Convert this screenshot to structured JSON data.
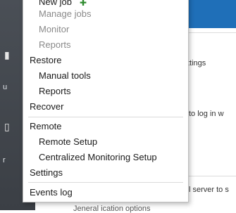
{
  "background": {
    "rail_fragments": [
      "u",
      "r"
    ],
    "right_fragments": [
      "ttings",
      "to log in w",
      "l server to s"
    ],
    "bottom_fragment": "Jeneral ication options"
  },
  "menu": {
    "items": [
      {
        "label": "New job",
        "level": "sub",
        "state": "enabled"
      },
      {
        "label": "Manage jobs",
        "level": "sub",
        "state": "disabled"
      },
      {
        "label": "Monitor",
        "level": "sub",
        "state": "disabled"
      },
      {
        "label": "Reports",
        "level": "sub",
        "state": "disabled"
      },
      {
        "label": "Restore",
        "level": "top",
        "state": "enabled"
      },
      {
        "label": "Manual tools",
        "level": "sub",
        "state": "enabled"
      },
      {
        "label": "Reports",
        "level": "sub",
        "state": "enabled"
      },
      {
        "label": "Recover",
        "level": "top",
        "state": "enabled"
      },
      {
        "label": "Remote",
        "level": "top",
        "state": "enabled"
      },
      {
        "label": "Remote Setup",
        "level": "sub",
        "state": "enabled"
      },
      {
        "label": "Centralized Monitoring Setup",
        "level": "sub",
        "state": "enabled"
      },
      {
        "label": "Settings",
        "level": "top",
        "state": "enabled"
      },
      {
        "label": "Events log",
        "level": "top",
        "state": "enabled"
      }
    ]
  },
  "colors": {
    "accent": "#1f6fb8",
    "rail": "#3b3f45",
    "disabled_text": "#8a8a8a"
  }
}
